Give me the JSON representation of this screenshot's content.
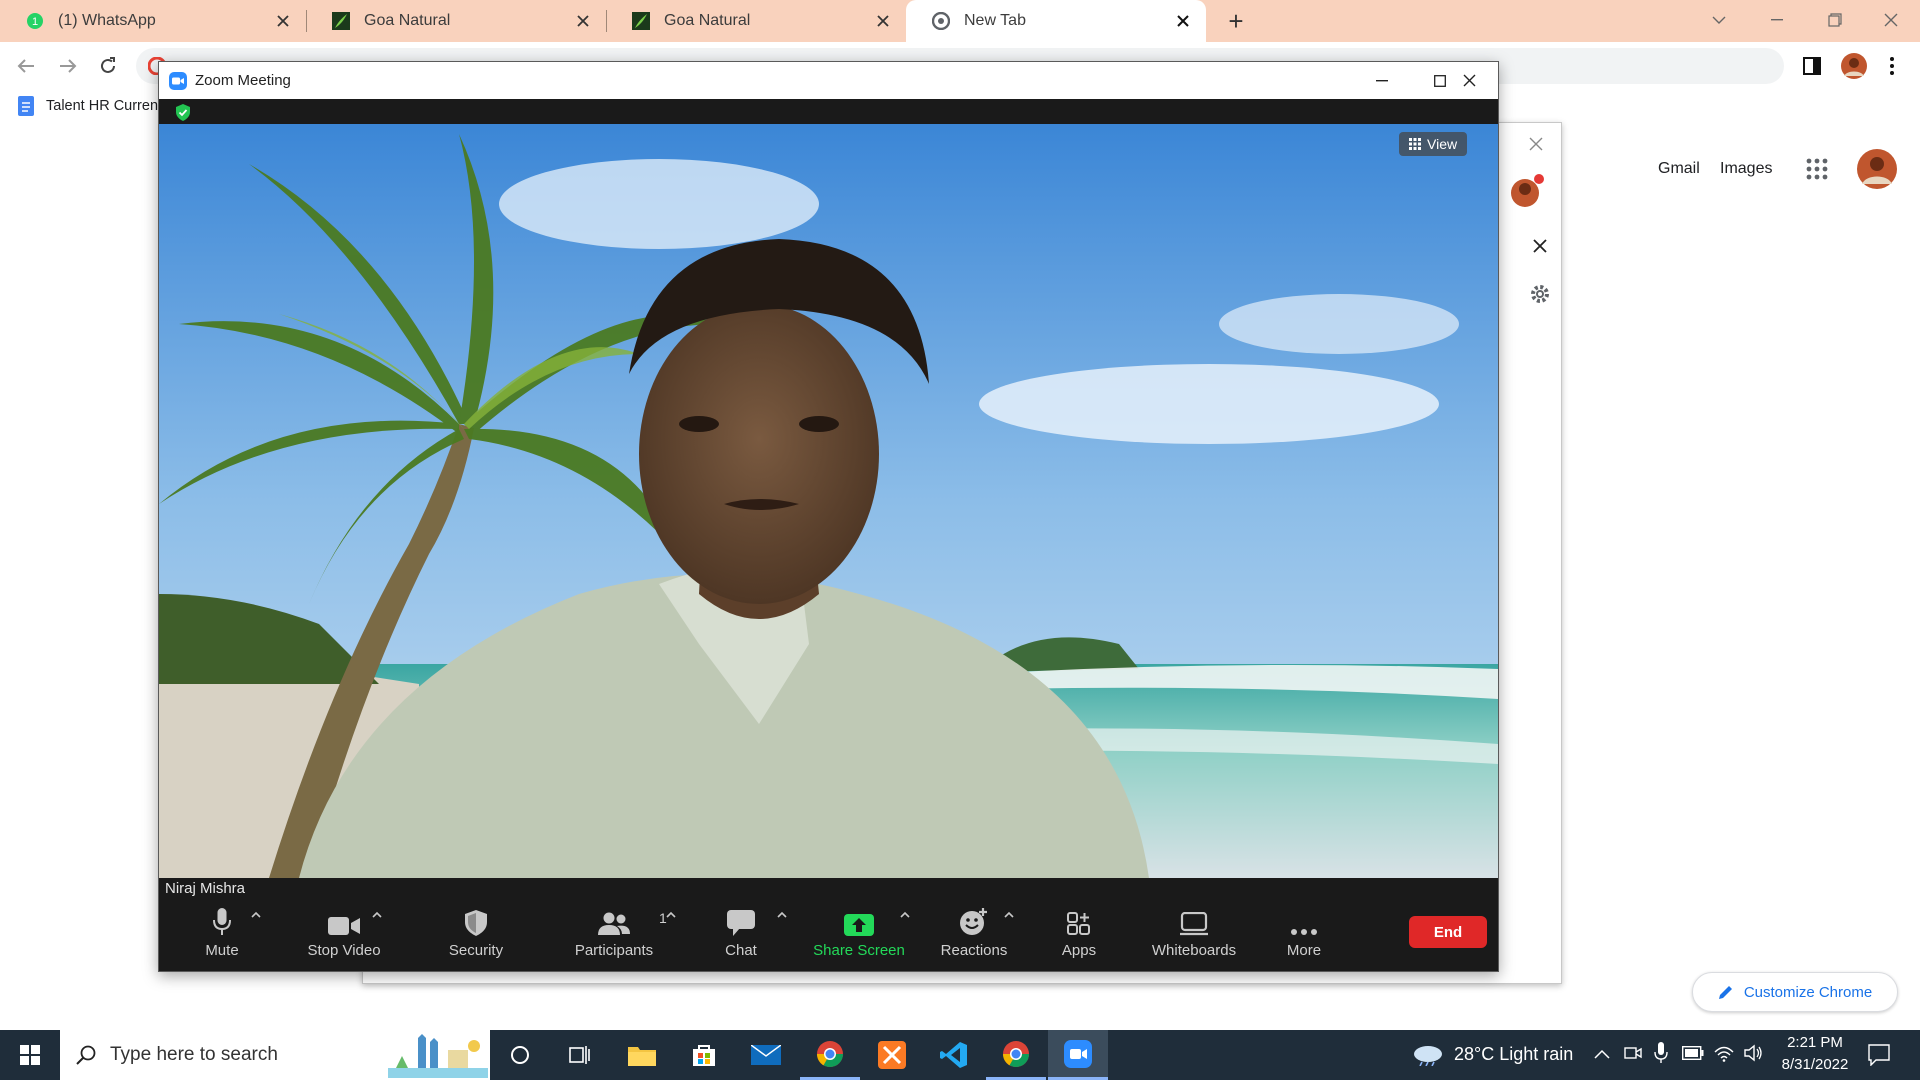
{
  "browser": {
    "tabs": [
      {
        "title": "(1) WhatsApp",
        "favicon": "whatsapp-icon"
      },
      {
        "title": "Goa Natural",
        "favicon": "goa-natural-icon"
      },
      {
        "title": "Goa Natural",
        "favicon": "goa-natural-icon"
      },
      {
        "title": "New Tab",
        "favicon": "chrome-icon",
        "active": true
      }
    ],
    "new_tab_symbol": "+",
    "bookmark": "Talent HR Curren",
    "google_links": {
      "gmail": "Gmail",
      "images": "Images"
    },
    "customize_label": "Customize Chrome",
    "colors": {
      "tabstrip": "#f9d2bd",
      "accent": "#1a73e8"
    }
  },
  "zoom": {
    "window_title": "Zoom Meeting",
    "view_label": "View",
    "participant_name": "Niraj Mishra",
    "participants_count": "1",
    "controls": [
      {
        "label": "Mute",
        "icon": "microphone-icon"
      },
      {
        "label": "Stop Video",
        "icon": "video-camera-icon"
      },
      {
        "label": "Security",
        "icon": "shield-icon"
      },
      {
        "label": "Participants",
        "icon": "participants-icon"
      },
      {
        "label": "Chat",
        "icon": "chat-icon"
      },
      {
        "label": "Share Screen",
        "icon": "share-screen-icon"
      },
      {
        "label": "Reactions",
        "icon": "reactions-icon"
      },
      {
        "label": "Apps",
        "icon": "apps-icon"
      },
      {
        "label": "Whiteboards",
        "icon": "whiteboard-icon"
      },
      {
        "label": "More",
        "icon": "more-icon"
      }
    ],
    "end_label": "End",
    "colors": {
      "share": "#23d959",
      "end": "#e02828",
      "brand": "#2d8cff"
    }
  },
  "taskbar": {
    "search_placeholder": "Type here to search",
    "weather": "28°C  Light rain",
    "time": "2:21 PM",
    "date": "8/31/2022",
    "apps": [
      "task-view-icon",
      "file-explorer-icon",
      "microsoft-store-icon",
      "mail-icon",
      "chrome-icon",
      "xampp-icon",
      "vscode-icon",
      "chrome-profile-icon",
      "zoom-icon"
    ]
  }
}
